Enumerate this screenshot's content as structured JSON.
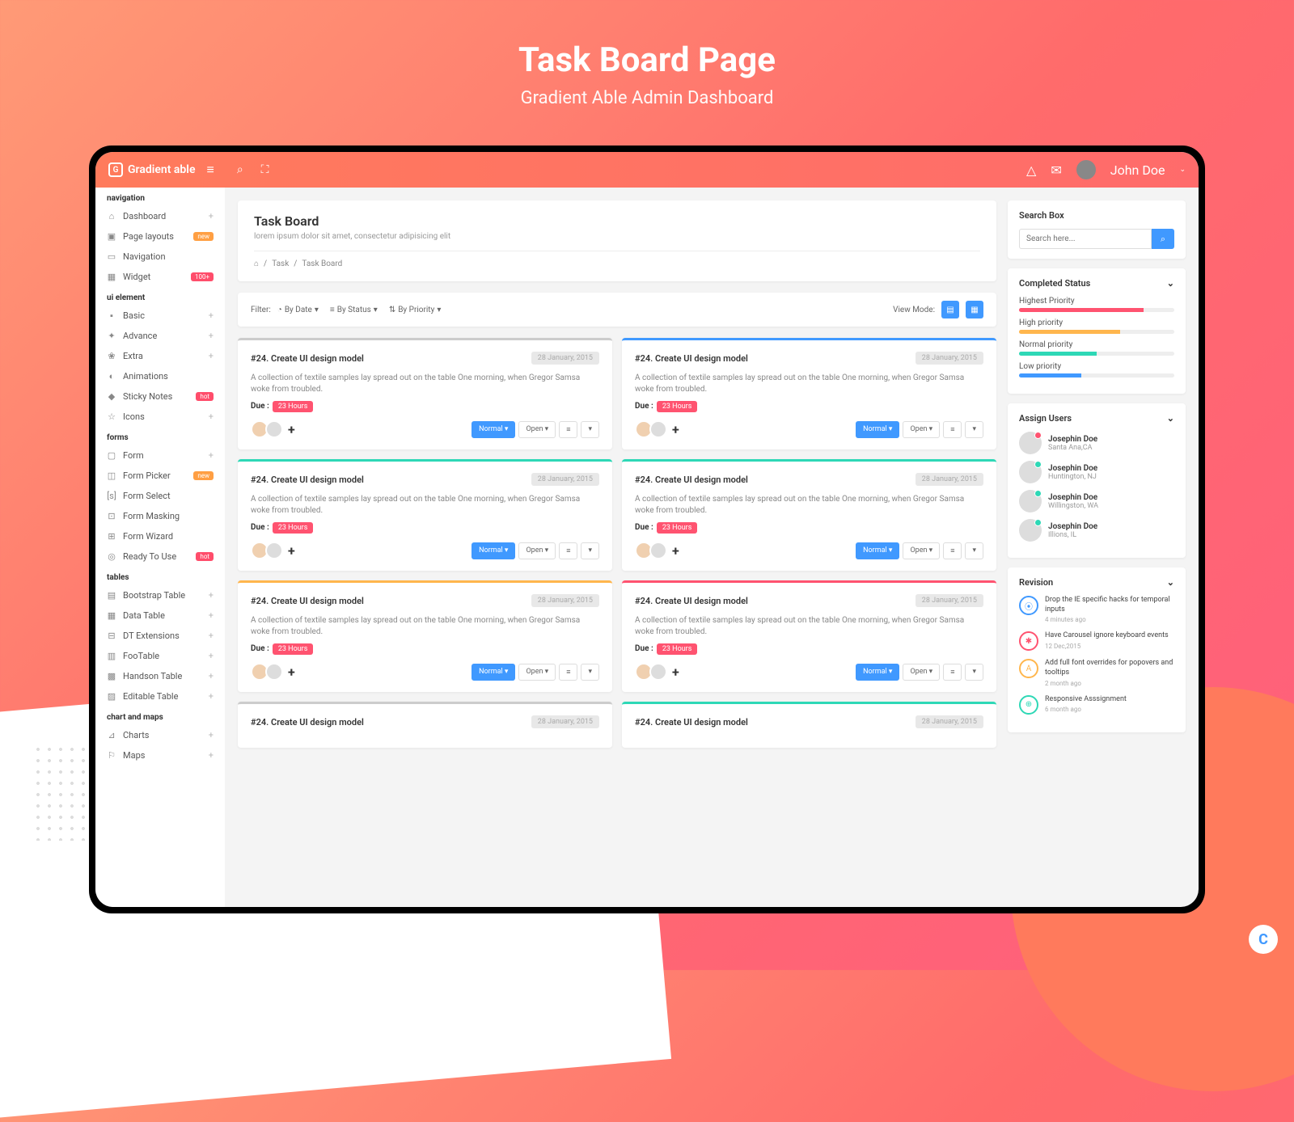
{
  "hero": {
    "title": "Task Board Page",
    "subtitle": "Gradient Able Admin Dashboard"
  },
  "brand": "Gradient able",
  "user": {
    "name": "John Doe"
  },
  "sidebar": {
    "groups": [
      {
        "label": "navigation",
        "items": [
          {
            "icon": "⌂",
            "label": "Dashboard",
            "plus": true,
            "badge": ""
          },
          {
            "icon": "▣",
            "label": "Page layouts",
            "plus": false,
            "badge": "new"
          },
          {
            "icon": "▭",
            "label": "Navigation",
            "plus": false,
            "badge": ""
          },
          {
            "icon": "▦",
            "label": "Widget",
            "plus": false,
            "badge": "100+"
          }
        ]
      },
      {
        "label": "ui element",
        "items": [
          {
            "icon": "▪",
            "label": "Basic",
            "plus": true,
            "badge": ""
          },
          {
            "icon": "✦",
            "label": "Advance",
            "plus": true,
            "badge": ""
          },
          {
            "icon": "❀",
            "label": "Extra",
            "plus": true,
            "badge": ""
          },
          {
            "icon": "◐",
            "label": "Animations",
            "plus": false,
            "badge": ""
          },
          {
            "icon": "◆",
            "label": "Sticky Notes",
            "plus": false,
            "badge": "hot"
          },
          {
            "icon": "☆",
            "label": "Icons",
            "plus": true,
            "badge": ""
          }
        ]
      },
      {
        "label": "forms",
        "items": [
          {
            "icon": "▢",
            "label": "Form",
            "plus": true,
            "badge": ""
          },
          {
            "icon": "◫",
            "label": "Form Picker",
            "plus": false,
            "badge": "new"
          },
          {
            "icon": "[s]",
            "label": "Form Select",
            "plus": false,
            "badge": ""
          },
          {
            "icon": "⊡",
            "label": "Form Masking",
            "plus": false,
            "badge": ""
          },
          {
            "icon": "⊞",
            "label": "Form Wizard",
            "plus": false,
            "badge": ""
          },
          {
            "icon": "◎",
            "label": "Ready To Use",
            "plus": false,
            "badge": "hot"
          }
        ]
      },
      {
        "label": "tables",
        "items": [
          {
            "icon": "▤",
            "label": "Bootstrap Table",
            "plus": true,
            "badge": ""
          },
          {
            "icon": "▦",
            "label": "Data Table",
            "plus": true,
            "badge": ""
          },
          {
            "icon": "⊟",
            "label": "DT Extensions",
            "plus": true,
            "badge": ""
          },
          {
            "icon": "▥",
            "label": "FooTable",
            "plus": true,
            "badge": ""
          },
          {
            "icon": "▩",
            "label": "Handson Table",
            "plus": true,
            "badge": ""
          },
          {
            "icon": "▨",
            "label": "Editable Table",
            "plus": true,
            "badge": ""
          }
        ]
      },
      {
        "label": "chart and maps",
        "items": [
          {
            "icon": "⊿",
            "label": "Charts",
            "plus": true,
            "badge": ""
          },
          {
            "icon": "⚐",
            "label": "Maps",
            "plus": true,
            "badge": ""
          }
        ]
      }
    ]
  },
  "header": {
    "title": "Task Board",
    "subtitle": "lorem ipsum dolor sit amet, consectetur adipisicing elit",
    "crumb": [
      "Task",
      "Task Board"
    ]
  },
  "filter": {
    "label": "Filter:",
    "opts": [
      "By Date",
      "By Status",
      "By Priority"
    ],
    "viewLabel": "View Mode:"
  },
  "tasks": [
    {
      "title": "#24. Create UI design model",
      "date": "28 January, 2015",
      "desc": "A collection of textile samples lay spread out on the table One morning, when Gregor Samsa woke from troubled.",
      "dueLabel": "Due :",
      "due": "23 Hours",
      "normal": "Normal",
      "open": "Open"
    },
    {
      "title": "#24. Create UI design model",
      "date": "28 January, 2015",
      "desc": "A collection of textile samples lay spread out on the table One morning, when Gregor Samsa woke from troubled.",
      "dueLabel": "Due :",
      "due": "23 Hours",
      "normal": "Normal",
      "open": "Open"
    },
    {
      "title": "#24. Create UI design model",
      "date": "28 January, 2015",
      "desc": "A collection of textile samples lay spread out on the table One morning, when Gregor Samsa woke from troubled.",
      "dueLabel": "Due :",
      "due": "23 Hours",
      "normal": "Normal",
      "open": "Open"
    },
    {
      "title": "#24. Create UI design model",
      "date": "28 January, 2015",
      "desc": "A collection of textile samples lay spread out on the table One morning, when Gregor Samsa woke from troubled.",
      "dueLabel": "Due :",
      "due": "23 Hours",
      "normal": "Normal",
      "open": "Open"
    },
    {
      "title": "#24. Create UI design model",
      "date": "28 January, 2015",
      "desc": "A collection of textile samples lay spread out on the table One morning, when Gregor Samsa woke from troubled.",
      "dueLabel": "Due :",
      "due": "23 Hours",
      "normal": "Normal",
      "open": "Open"
    },
    {
      "title": "#24. Create UI design model",
      "date": "28 January, 2015",
      "desc": "A collection of textile samples lay spread out on the table One morning, when Gregor Samsa woke from troubled.",
      "dueLabel": "Due :",
      "due": "23 Hours",
      "normal": "Normal",
      "open": "Open"
    },
    {
      "title": "#24. Create UI design model",
      "date": "28 January, 2015",
      "desc": "",
      "dueLabel": "",
      "due": "",
      "normal": "",
      "open": ""
    },
    {
      "title": "#24. Create UI design model",
      "date": "28 January, 2015",
      "desc": "",
      "dueLabel": "",
      "due": "",
      "normal": "",
      "open": ""
    }
  ],
  "searchBox": {
    "title": "Search Box",
    "placeholder": "Search here..."
  },
  "completed": {
    "title": "Completed Status",
    "rows": [
      {
        "label": "Highest Priority",
        "pct": 80,
        "color": "#ff5370"
      },
      {
        "label": "High priority",
        "pct": 65,
        "color": "#ffb64d"
      },
      {
        "label": "Normal priority",
        "pct": 50,
        "color": "#2ed8b6"
      },
      {
        "label": "Low priority",
        "pct": 40,
        "color": "#4099ff"
      }
    ]
  },
  "assign": {
    "title": "Assign Users",
    "users": [
      {
        "name": "Josephin Doe",
        "loc": "Santa Ana,CA",
        "status": "off"
      },
      {
        "name": "Josephin Doe",
        "loc": "Huntington, NJ",
        "status": "on"
      },
      {
        "name": "Josephin Doe",
        "loc": "Willingston, WA",
        "status": "on"
      },
      {
        "name": "Josephin Doe",
        "loc": "Illions, IL",
        "status": "on"
      }
    ]
  },
  "revision": {
    "title": "Revision",
    "items": [
      {
        "icon": "⦿",
        "text": "Drop the IE specific hacks for temporal inputs",
        "date": "4 minutes ago"
      },
      {
        "icon": "✱",
        "text": "Have Carousel ignore keyboard events",
        "date": "12 Dec,2015"
      },
      {
        "icon": "A",
        "text": "Add full font overrides for popovers and tooltips",
        "date": "2 month ago"
      },
      {
        "icon": "⊕",
        "text": "Responsive Asssignment",
        "date": "6 month ago"
      }
    ]
  }
}
